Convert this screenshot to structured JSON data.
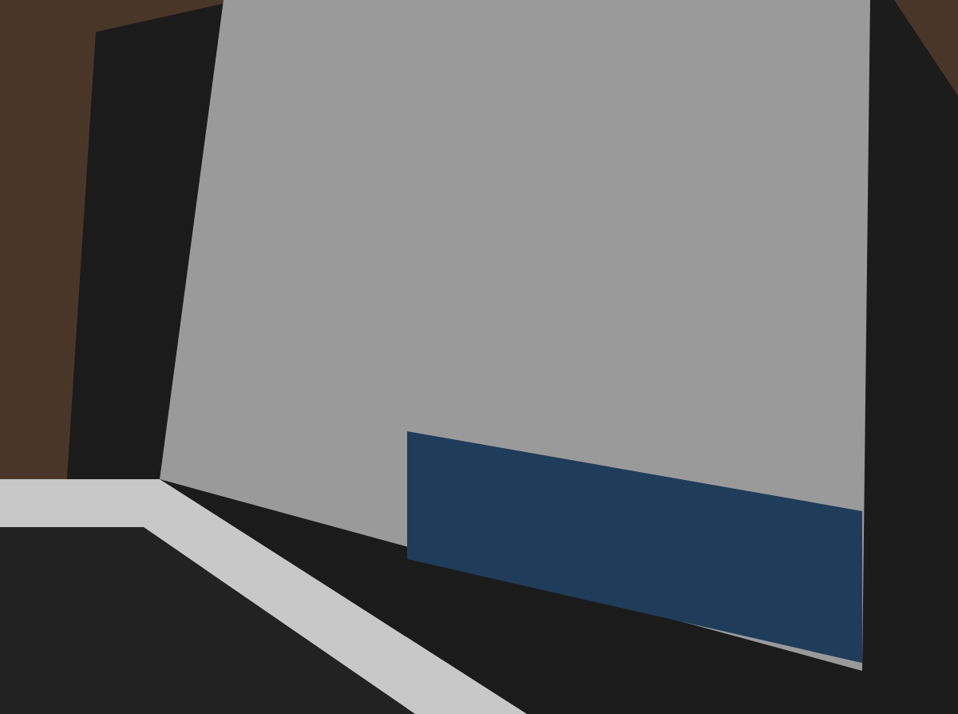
{
  "photo": {
    "kind": "laptop"
  }
}
